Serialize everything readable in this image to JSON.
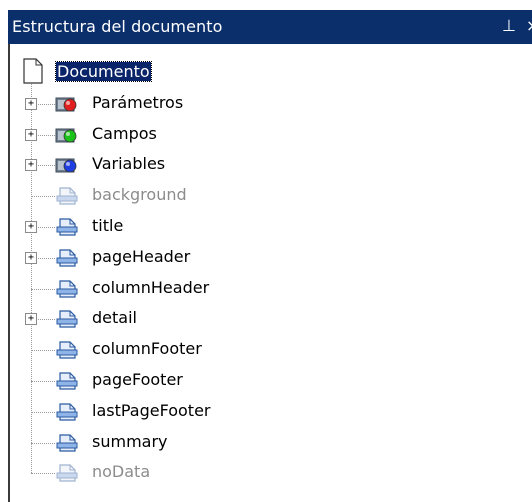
{
  "panel": {
    "title": "Estructura del documento",
    "pin_icon": "pin-icon",
    "close_icon": "close-icon"
  },
  "tree": {
    "root": {
      "label": "Documento",
      "selected": true,
      "icon": "document-icon"
    },
    "items": [
      {
        "label": "Parámetros",
        "expandable": true,
        "disabled": false,
        "icon": "folder-red-dot-icon"
      },
      {
        "label": "Campos",
        "expandable": true,
        "disabled": false,
        "icon": "folder-green-dot-icon"
      },
      {
        "label": "Variables",
        "expandable": true,
        "disabled": false,
        "icon": "folder-blue-dot-icon"
      },
      {
        "label": "background",
        "expandable": false,
        "disabled": true,
        "icon": "band-icon"
      },
      {
        "label": "title",
        "expandable": true,
        "disabled": false,
        "icon": "band-icon"
      },
      {
        "label": "pageHeader",
        "expandable": true,
        "disabled": false,
        "icon": "band-icon"
      },
      {
        "label": "columnHeader",
        "expandable": false,
        "disabled": false,
        "icon": "band-icon"
      },
      {
        "label": "detail",
        "expandable": true,
        "disabled": false,
        "icon": "band-icon"
      },
      {
        "label": "columnFooter",
        "expandable": false,
        "disabled": false,
        "icon": "band-icon"
      },
      {
        "label": "pageFooter",
        "expandable": false,
        "disabled": false,
        "icon": "band-icon"
      },
      {
        "label": "lastPageFooter",
        "expandable": false,
        "disabled": false,
        "icon": "band-icon"
      },
      {
        "label": "summary",
        "expandable": false,
        "disabled": false,
        "icon": "band-icon"
      },
      {
        "label": "noData",
        "expandable": false,
        "disabled": true,
        "icon": "band-icon"
      }
    ]
  },
  "colors": {
    "title_bg": "#0a2f6b",
    "selection_bg": "#0a246a",
    "disabled_text": "#8c8c8c",
    "red_dot": "#e02020",
    "green_dot": "#19c119",
    "blue_dot": "#1f3fe0"
  }
}
